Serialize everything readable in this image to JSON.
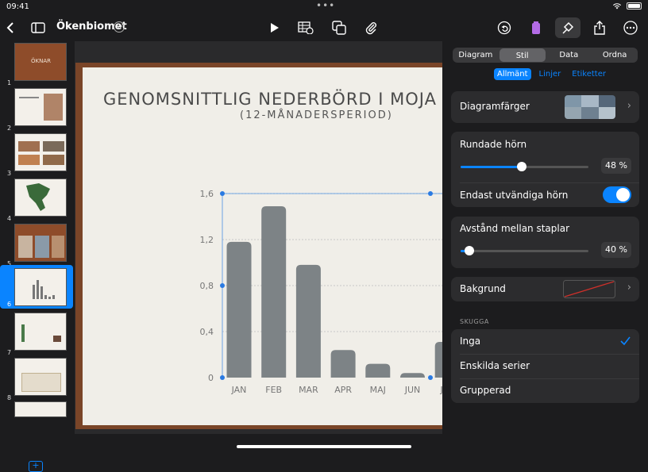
{
  "status": {
    "time": "09:41",
    "dots": "•••"
  },
  "toolbar": {
    "doc_title": "Ökenbiomet",
    "icons": [
      "back-icon",
      "sidebar-icon",
      "chevron-down-icon",
      "play-icon",
      "table-icon",
      "shapes-icon",
      "paperclip-icon",
      "undo-icon",
      "collab-icon",
      "format-brush-icon",
      "share-icon",
      "more-icon"
    ]
  },
  "slides": [
    {
      "num": "1",
      "title": "ÖKNAR"
    },
    {
      "num": "2"
    },
    {
      "num": "3"
    },
    {
      "num": "4"
    },
    {
      "num": "5"
    },
    {
      "num": "6"
    },
    {
      "num": "7"
    },
    {
      "num": "8"
    }
  ],
  "slide": {
    "title": "GENOMSNITTLIG NEDERBÖRD I MOJA",
    "subtitle": "(12-MÅNADERSPERIOD)"
  },
  "chart_data": {
    "type": "bar",
    "categories": [
      "JAN",
      "FEB",
      "MAR",
      "APR",
      "MAJ",
      "JUN",
      "JUL"
    ],
    "values": [
      1.18,
      1.49,
      0.98,
      0.24,
      0.12,
      0.04,
      0.31
    ],
    "yticks": [
      "0",
      "0,4",
      "0,8",
      "1,2",
      "1,6"
    ],
    "ylim": [
      0,
      1.6
    ],
    "bar_color": "#7d8386",
    "grid": true
  },
  "panel": {
    "tabs": [
      "Diagram",
      "Stil",
      "Data",
      "Ordna"
    ],
    "active_tab": "Stil",
    "subtabs": [
      "Allmänt",
      "Linjer",
      "Etiketter"
    ],
    "chart_colors_label": "Diagramfärger",
    "rounded_label": "Rundade hörn",
    "rounded_value": "48 %",
    "rounded_fraction": 0.48,
    "outer_only_label": "Endast utvändiga hörn",
    "outer_only_on": true,
    "gap_label": "Avstånd mellan staplar",
    "gap_value": "40 %",
    "gap_fraction": 0.04,
    "background_label": "Bakgrund",
    "shadow_header": "SKUGGA",
    "shadow_options": [
      "Inga",
      "Enskilda serier",
      "Grupperad"
    ],
    "shadow_selected": "Inga",
    "accent": "#0a84ff"
  }
}
